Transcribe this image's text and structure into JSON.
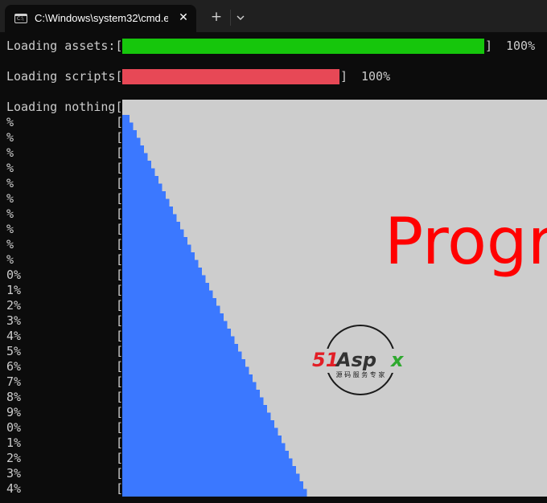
{
  "window": {
    "tab_title": "C:\\Windows\\system32\\cmd.e:",
    "tab_icon": "cmd-icon",
    "close_glyph": "✕",
    "new_tab_glyph": "+",
    "dropdown_icon": "chevron-down-icon"
  },
  "terminal": {
    "lines": [
      {
        "label": "Loading assets:[",
        "progress": 1.0,
        "close": "]",
        "percent": "100%",
        "color": "#16c60c"
      },
      {
        "label": "Loading scripts[",
        "progress": 1.0,
        "close": "]",
        "percent": "100%",
        "color": "#e74856"
      },
      {
        "label": "Loading nothing[",
        "progress": null,
        "close": "",
        "percent": "",
        "color": "#3b78ff"
      }
    ],
    "row_labels": [
      "%",
      "%",
      "%",
      "%",
      "%",
      "%",
      "%",
      "%",
      "%",
      "%",
      "0%",
      "1%",
      "2%",
      "3%",
      "4%",
      "5%",
      "6%",
      "7%",
      "8%",
      "9%",
      "0%",
      "1%",
      "2%",
      "3%",
      "4%"
    ],
    "bracket": "[",
    "stair_color": "#3b78ff"
  },
  "overlay": {
    "text": "Progr",
    "text_color": "#ff0000",
    "background": "#cdcdcd",
    "logo_number": "51",
    "logo_word": "Aspx",
    "logo_tagline": "源 码 服 务 专 家",
    "logo_colors": {
      "number": "#e21e26",
      "word": "#333333",
      "x": "#2ea82e"
    }
  }
}
